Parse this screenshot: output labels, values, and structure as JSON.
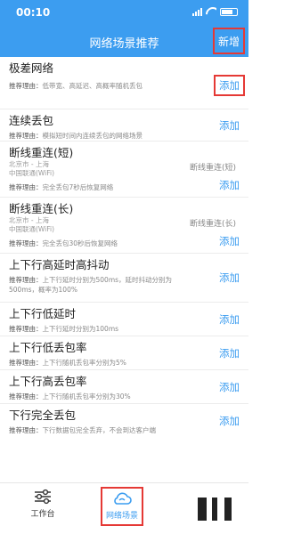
{
  "status": {
    "time": "00:10"
  },
  "nav": {
    "title": "网络场景推荐",
    "add_label": "新增"
  },
  "reason_label": "推荐理由：",
  "add_label": "添加",
  "scenes": [
    {
      "title": "极差网络",
      "reason": "低带宽、高延迟、高概率随机丢包"
    },
    {
      "title": "连续丢包",
      "reason": "模拟短时间内连续丢包的网络场景"
    },
    {
      "title": "断线重连(短)",
      "location": "北京市 - 上海",
      "carrier": "中国联通(WiFi)",
      "mode": "断线重连(短)",
      "reason": "完全丢包7秒后恢复网络"
    },
    {
      "title": "断线重连(长)",
      "location": "北京市 - 上海",
      "carrier": "中国联通(WiFi)",
      "mode": "断线重连(长)",
      "reason": "完全丢包30秒后恢复网络"
    },
    {
      "title": "上下行高延时高抖动",
      "reason": "上下行延时分别为500ms，延时抖动分别为500ms，概率为100%"
    },
    {
      "title": "上下行低延时",
      "reason": "上下行延时分别为100ms"
    },
    {
      "title": "上下行低丢包率",
      "reason": "上下行随机丢包率分别为5%"
    },
    {
      "title": "上下行高丢包率",
      "reason": "上下行随机丢包率分别为30%"
    },
    {
      "title": "下行完全丢包",
      "reason": "下行数据包完全丢弃，不会到达客户端"
    }
  ],
  "tabs": {
    "work": "工作台",
    "scene": "网络场景"
  },
  "colors": {
    "primary": "#3c9df0",
    "highlight": "#e53935"
  }
}
